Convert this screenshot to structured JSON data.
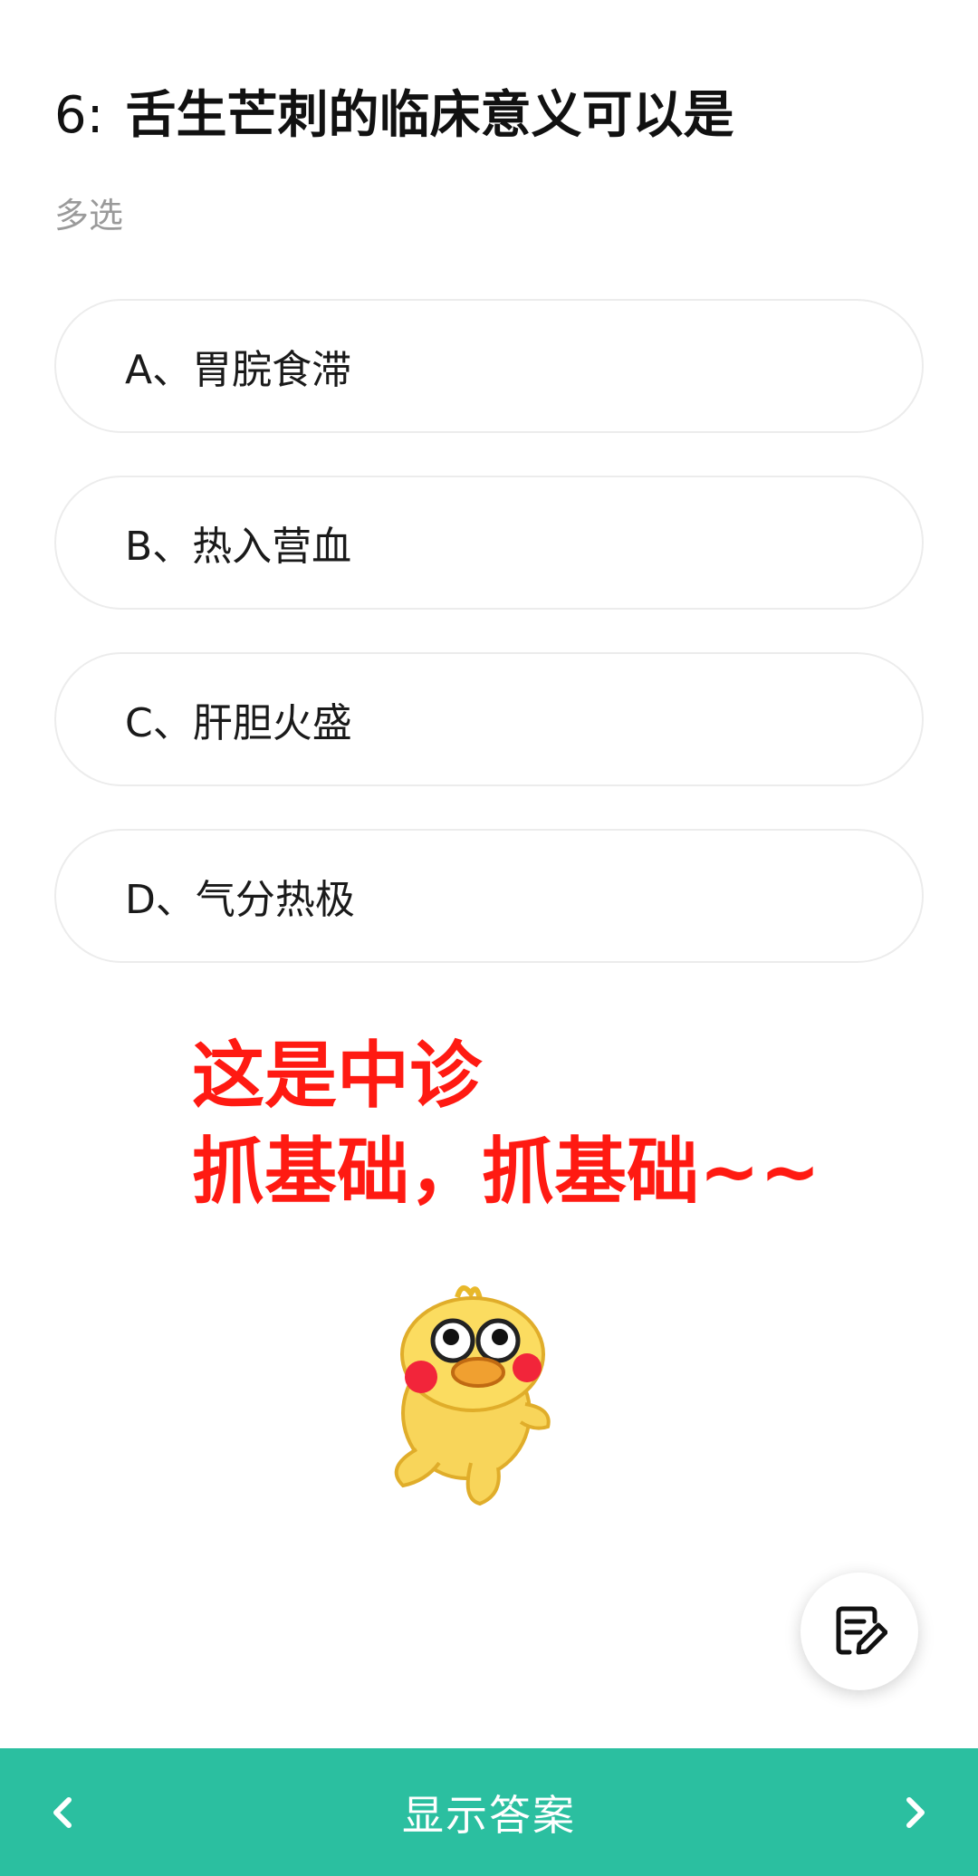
{
  "question": {
    "number": "6:",
    "text": "舌生芒刺的临床意义可以是",
    "type": "多选"
  },
  "options": [
    {
      "label": "A、胃脘食滞"
    },
    {
      "label": "B、热入营血"
    },
    {
      "label": "C、肝胆火盛"
    },
    {
      "label": "D、气分热极"
    }
  ],
  "annotation": {
    "line1": "这是中诊",
    "line2": "抓基础，抓基础~~",
    "color": "#ff1a12"
  },
  "bottom_bar": {
    "show_answer_label": "显示答案",
    "prev_icon": "chevron-left-icon",
    "next_icon": "chevron-right-icon",
    "color": "#2bbfa0"
  },
  "fab": {
    "icon": "edit-note-icon"
  },
  "sticker": {
    "icon": "duck-sticker"
  }
}
